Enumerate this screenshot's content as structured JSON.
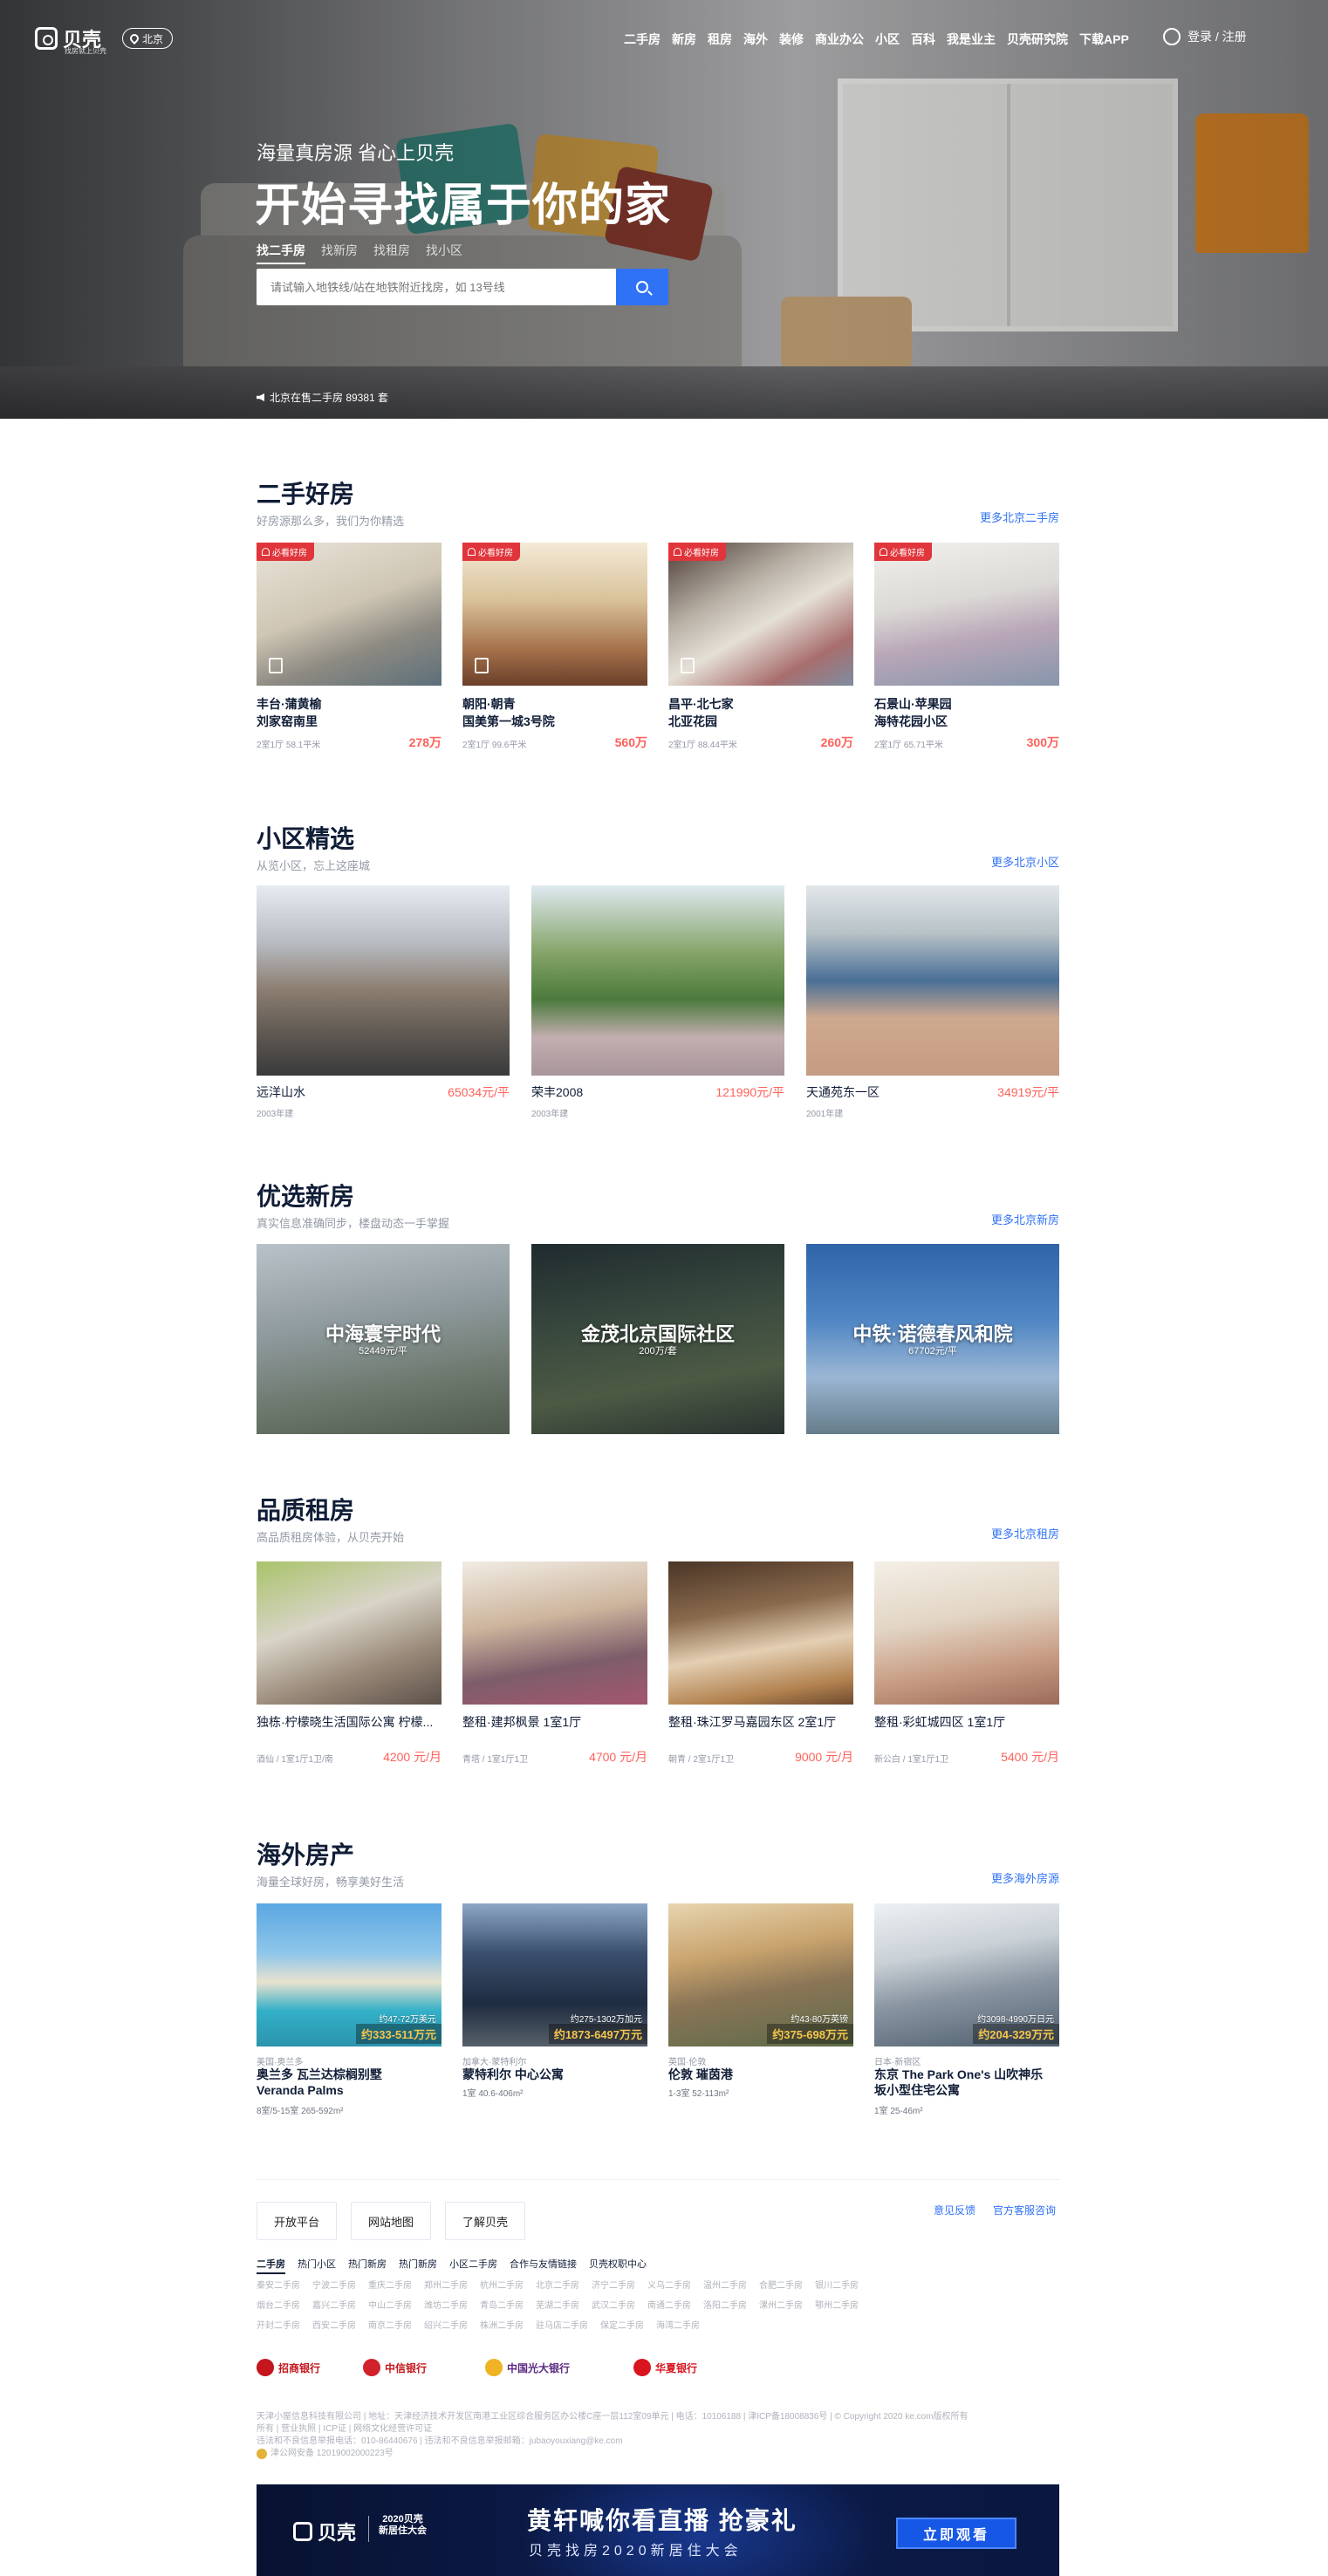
{
  "header": {
    "logo_text": "贝壳",
    "logo_sub": "找房就上贝壳",
    "city": "北京",
    "nav": [
      "二手房",
      "新房",
      "租房",
      "海外",
      "装修",
      "商业办公",
      "小区",
      "百科",
      "我是业主",
      "贝壳研究院",
      "下载APP"
    ],
    "login": "登录 / 注册"
  },
  "hero": {
    "subtitle": "海量真房源 省心上贝壳",
    "title": "开始寻找属于你的家",
    "tabs": [
      "找二手房",
      "找新房",
      "找租房",
      "找小区"
    ],
    "search_placeholder": "请试输入地铁线/站在地铁附近找房，如 13号线",
    "stat": "北京在售二手房 89381 套"
  },
  "second_hand": {
    "title": "二手好房",
    "subtitle": "好房源那么多，我们为你精选",
    "more": "更多北京二手房",
    "badge": "必看好房",
    "items": [
      {
        "title1": "丰台·蒲黄榆",
        "title2": "刘家窑南里",
        "meta": "2室1厅 58.1平米",
        "price": "278万"
      },
      {
        "title1": "朝阳·朝青",
        "title2": "国美第一城3号院",
        "meta": "2室1厅 99.6平米",
        "price": "560万"
      },
      {
        "title1": "昌平·北七家",
        "title2": "北亚花园",
        "meta": "2室1厅 88.44平米",
        "price": "260万"
      },
      {
        "title1": "石景山·苹果园",
        "title2": "海特花园小区",
        "meta": "2室1厅 65.71平米",
        "price": "300万"
      }
    ]
  },
  "communities": {
    "title": "小区精选",
    "subtitle": "从览小区，忘上这座城",
    "more": "更多北京小区",
    "items": [
      {
        "name": "远洋山水",
        "year": "2003年建",
        "price": "65034元/平"
      },
      {
        "name": "荣丰2008",
        "year": "2003年建",
        "price": "121990元/平"
      },
      {
        "name": "天通苑东一区",
        "year": "2001年建",
        "price": "34919元/平"
      }
    ]
  },
  "new_homes": {
    "title": "优选新房",
    "subtitle": "真实信息准确同步，楼盘动态一手掌握",
    "more": "更多北京新房",
    "items": [
      {
        "name": "中海寰宇时代",
        "price": "52449元/平"
      },
      {
        "name": "金茂北京国际社区",
        "price": "200万/套"
      },
      {
        "name": "中铁·诺德春风和院",
        "price": "67702元/平"
      }
    ]
  },
  "rentals": {
    "title": "品质租房",
    "subtitle": "高品质租房体验，从贝壳开始",
    "more": "更多北京租房",
    "items": [
      {
        "title": "独栋·柠檬晓生活国际公寓 柠檬...",
        "meta": "酒仙 / 1室1厅1卫/南",
        "price": "4200 元/月"
      },
      {
        "title": "整租·建邦枫景 1室1厅",
        "meta": "青塔 / 1室1厅1卫",
        "price": "4700 元/月"
      },
      {
        "title": "整租·珠江罗马嘉园东区 2室1厅",
        "meta": "朝青 / 2室1厅1卫",
        "price": "9000 元/月"
      },
      {
        "title": "整租·彩虹城四区 1室1厅",
        "meta": "新公白 / 1室1厅1卫",
        "price": "5400 元/月"
      }
    ]
  },
  "overseas": {
    "title": "海外房产",
    "subtitle": "海量全球好房，畅享美好生活",
    "more": "更多海外房源",
    "items": [
      {
        "region": "美国·奥兰多",
        "name1": "奥兰多 瓦兰达棕榈别墅",
        "name2": "Veranda Palms",
        "meta": "8室/5-15室 265-592m²",
        "usd": "约47-72万美元",
        "cny": "约333-511万元"
      },
      {
        "region": "加拿大·蒙特利尔",
        "name1": "蒙特利尔 中心公寓",
        "name2": "",
        "meta": "1室 40.6-406m²",
        "usd": "约275-1302万加元",
        "cny": "约1873-6497万元"
      },
      {
        "region": "英国·伦敦",
        "name1": "伦敦 璀茵港",
        "name2": "",
        "meta": "1-3室 52-113m²",
        "usd": "约43-80万英镑",
        "cny": "约375-698万元"
      },
      {
        "region": "日本·新宿区",
        "name1": "东京 The Park One's 山吹神乐",
        "name2": "坂小型住宅公寓",
        "meta": "1室 25-46m²",
        "usd": "约3098-4990万日元",
        "cny": "约204-329万元"
      }
    ]
  },
  "footer": {
    "buttons": [
      "开放平台",
      "网站地图",
      "了解贝壳"
    ],
    "feedback": "意见反馈",
    "service": "官方客服咨询",
    "link_tabs": [
      "二手房",
      "热门小区",
      "热门新房",
      "热门新房",
      "小区二手房",
      "合作与友情链接",
      "贝壳权职中心"
    ],
    "city_rows": [
      [
        "秦安二手房",
        "宁波二手房",
        "重庆二手房",
        "郑州二手房",
        "杭州二手房",
        "北京二手房",
        "济宁二手房",
        "义乌二手房",
        "温州二手房",
        "合肥二手房",
        "银川二手房"
      ],
      [
        "烟台二手房",
        "嘉兴二手房",
        "中山二手房",
        "潍坊二手房",
        "青岛二手房",
        "芜湖二手房",
        "武汉二手房",
        "南通二手房",
        "洛阳二手房",
        "漯州二手房",
        "鄂州二手房"
      ],
      [
        "开封二手房",
        "西安二手房",
        "南京二手房",
        "绍兴二手房",
        "株洲二手房",
        "驻马店二手房",
        "保定二手房",
        "海湾二手房"
      ]
    ],
    "banks": [
      "招商银行",
      "中信银行",
      "中国光大银行",
      "华夏银行"
    ],
    "legal": [
      "天津小屋信息科技有限公司 | 地址：天津经济技术开发区南港工业区综合服务区办公楼C座一层112室09单元 | 电话：10106188 | 津ICP备18008836号 | © Copyright 2020 ke.com版权所有",
      "所有 | 营业执照 | ICP证 | 网络文化经营许可证",
      "违法和不良信息举报电话：010-86440676 | 违法和不良信息举报邮箱：jubaoyouxiang@ke.com",
      "津公网安备 12019002000223号"
    ]
  },
  "banner": {
    "logo": "贝壳",
    "event_line1": "2020贝壳",
    "event_line2": "新居住大会",
    "title": "黄轩喊你看直播 抢豪礼",
    "subtitle": "贝壳找房2020新居住大会",
    "button": "立即观看"
  },
  "colors": {
    "accent": "#3072f6",
    "price": "#fe615a",
    "badge": "#e0353b",
    "title": "#101d37"
  }
}
